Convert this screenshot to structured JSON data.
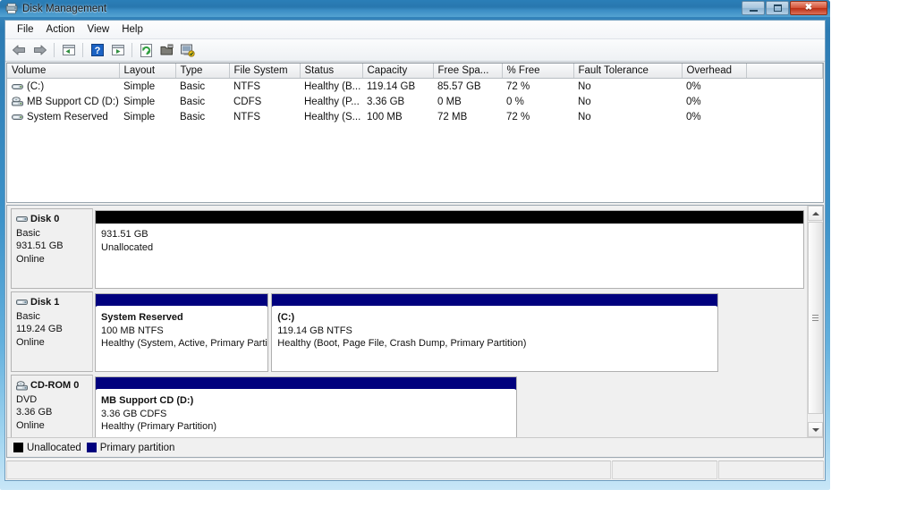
{
  "window": {
    "title": "Disk Management",
    "title_icon": "disk-management-icon",
    "minimize_label": "Minimize",
    "maximize_label": "Maximize",
    "close_label": "Close"
  },
  "menubar": {
    "items": [
      {
        "label": "File",
        "name": "menu-file"
      },
      {
        "label": "Action",
        "name": "menu-action"
      },
      {
        "label": "View",
        "name": "menu-view"
      },
      {
        "label": "Help",
        "name": "menu-help"
      }
    ]
  },
  "toolbar": {
    "buttons": [
      {
        "name": "back-icon",
        "tip": "Back"
      },
      {
        "name": "forward-icon",
        "tip": "Forward"
      },
      {
        "name": "up-one-level-icon",
        "tip": "Up One Level"
      },
      {
        "name": "help-icon",
        "tip": "Help"
      },
      {
        "name": "show-console-tree-icon",
        "tip": "Show/Hide Console Tree"
      },
      {
        "name": "refresh-icon",
        "tip": "Refresh"
      },
      {
        "name": "properties-icon",
        "tip": "Properties"
      },
      {
        "name": "rescan-disks-icon",
        "tip": "Rescan Disks"
      }
    ]
  },
  "volume_list": {
    "columns": [
      "Volume",
      "Layout",
      "Type",
      "File System",
      "Status",
      "Capacity",
      "Free Spa...",
      "% Free",
      "Fault Tolerance",
      "Overhead"
    ],
    "rows": [
      {
        "icon": "hard-disk-volume-icon",
        "volume": "(C:)",
        "layout": "Simple",
        "type": "Basic",
        "file_system": "NTFS",
        "status": "Healthy (B...",
        "capacity": "119.14 GB",
        "free_space": "85.57 GB",
        "percent_free": "72 %",
        "fault_tolerance": "No",
        "overhead": "0%"
      },
      {
        "icon": "cdrom-volume-icon",
        "volume": "MB Support CD (D:)",
        "layout": "Simple",
        "type": "Basic",
        "file_system": "CDFS",
        "status": "Healthy (P...",
        "capacity": "3.36 GB",
        "free_space": "0 MB",
        "percent_free": "0 %",
        "fault_tolerance": "No",
        "overhead": "0%"
      },
      {
        "icon": "hard-disk-volume-icon",
        "volume": "System Reserved",
        "layout": "Simple",
        "type": "Basic",
        "file_system": "NTFS",
        "status": "Healthy (S...",
        "capacity": "100 MB",
        "free_space": "72 MB",
        "percent_free": "72 %",
        "fault_tolerance": "No",
        "overhead": "0%"
      }
    ]
  },
  "graphical_view": {
    "disks": [
      {
        "icon": "disk-drive-icon",
        "title": "Disk 0",
        "type": "Basic",
        "size": "931.51 GB",
        "state": "Online",
        "partitions": [
          {
            "kind": "unallocated",
            "name": "",
            "size_fs": "931.51 GB",
            "status": "Unallocated",
            "width_pct": 100
          }
        ]
      },
      {
        "icon": "disk-drive-icon",
        "title": "Disk 1",
        "type": "Basic",
        "size": "119.24 GB",
        "state": "Online",
        "partitions": [
          {
            "kind": "primary",
            "name": "System Reserved",
            "size_fs": "100 MB NTFS",
            "status": "Healthy (System, Active, Primary Partit",
            "width_pct": 25
          },
          {
            "kind": "primary",
            "name": "(C:)",
            "size_fs": "119.14 GB NTFS",
            "status": "Healthy (Boot, Page File, Crash Dump, Primary Partition)",
            "width_pct": 63
          }
        ]
      },
      {
        "icon": "cdrom-drive-icon",
        "title": "CD-ROM 0",
        "type": "DVD",
        "size": "3.36 GB",
        "state": "Online",
        "partitions": [
          {
            "kind": "primary",
            "name": "MB Support CD  (D:)",
            "size_fs": "3.36 GB CDFS",
            "status": "Healthy (Primary Partition)",
            "width_pct": 60
          }
        ]
      }
    ],
    "scrollbar": {
      "up_label": "Scroll up",
      "down_label": "Scroll down",
      "thumb_label": "Scroll thumb"
    }
  },
  "legend": {
    "items": [
      {
        "label": "Unallocated",
        "color": "#000000",
        "swatch": "black"
      },
      {
        "label": "Primary partition",
        "color": "#00007e",
        "swatch": "blue"
      }
    ]
  },
  "statusbar": {
    "pane1": "",
    "pane2": "",
    "pane3": ""
  }
}
